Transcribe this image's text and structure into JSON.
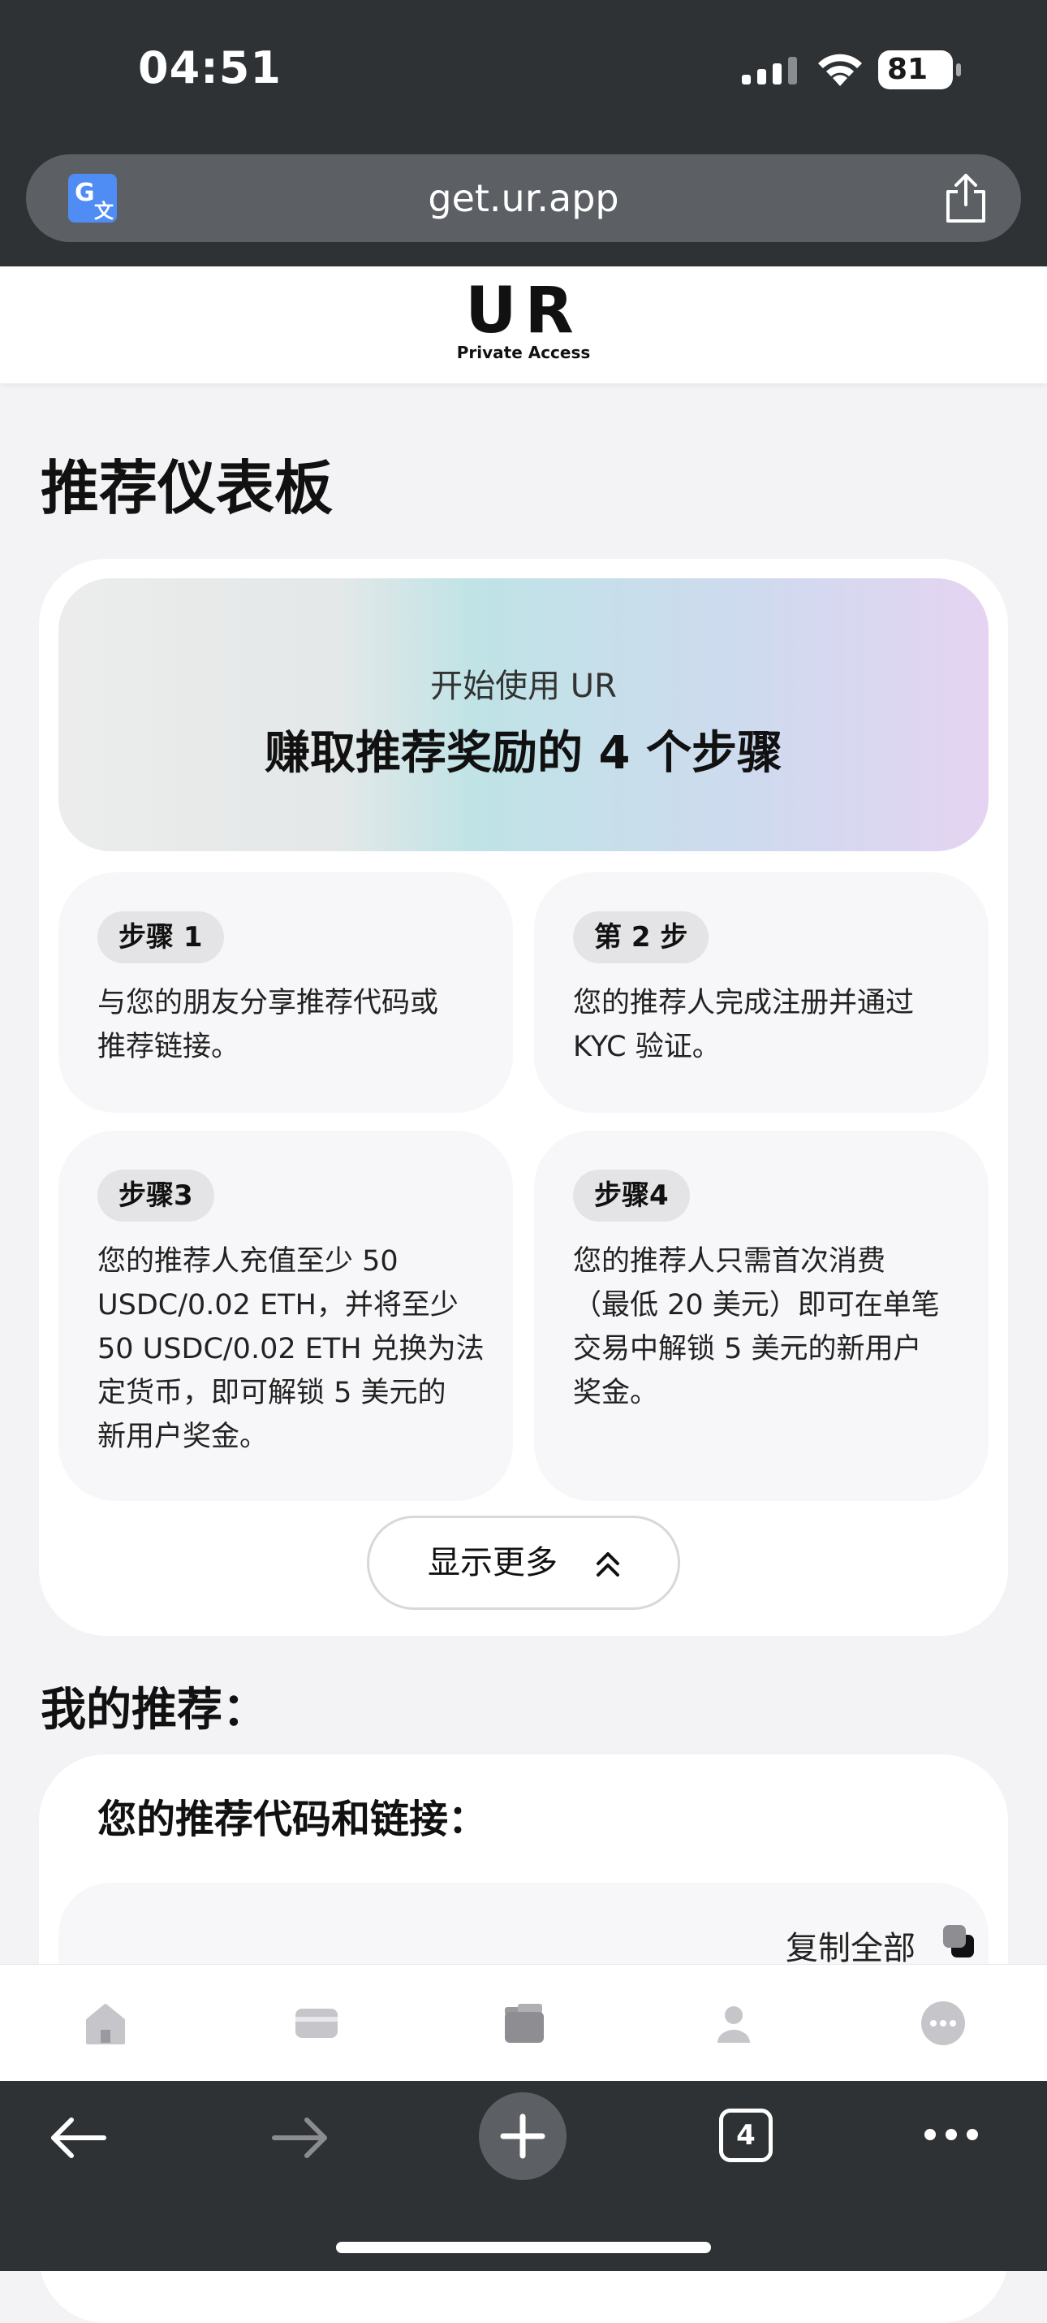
{
  "status_bar": {
    "time": "04:51",
    "battery": "81"
  },
  "browser": {
    "url": "get.ur.app",
    "tabs_count": "4"
  },
  "site_header": {
    "logo": "UR",
    "logo_sub": "Private Access"
  },
  "page": {
    "title": "推荐仪表板"
  },
  "steps_card": {
    "hero_subtitle": "开始使用 UR",
    "hero_title": "赚取推荐奖励的 4 个步骤",
    "steps": [
      {
        "badge": "步骤 1",
        "text": "与您的朋友分享推荐代码或\n推荐链接。"
      },
      {
        "badge": "第 2 步",
        "text": "您的推荐人完成注册并通过\nKYC 验证。"
      },
      {
        "badge": "步骤3",
        "text": "您的推荐人充值至少 50\nUSDC/0.02 ETH，并将至少\n50 USDC/0.02 ETH 兑换为法\n定货币，即可解锁 5 美元的\n新用户奖金。"
      },
      {
        "badge": "步骤4",
        "text": "您的推荐人只需首次消费\n（最低 20 美元）即可在单笔\n交易中解锁 5 美元的新用户\n奖金。"
      }
    ],
    "show_more": "显示更多"
  },
  "referrals": {
    "section_title": "我的推荐：",
    "card_title": "您的推荐代码和链接：",
    "copy_all": "复制全部"
  },
  "site_nav": {
    "items": [
      "home-icon",
      "card-icon",
      "wallet-icon",
      "profile-icon",
      "more-icon"
    ]
  }
}
